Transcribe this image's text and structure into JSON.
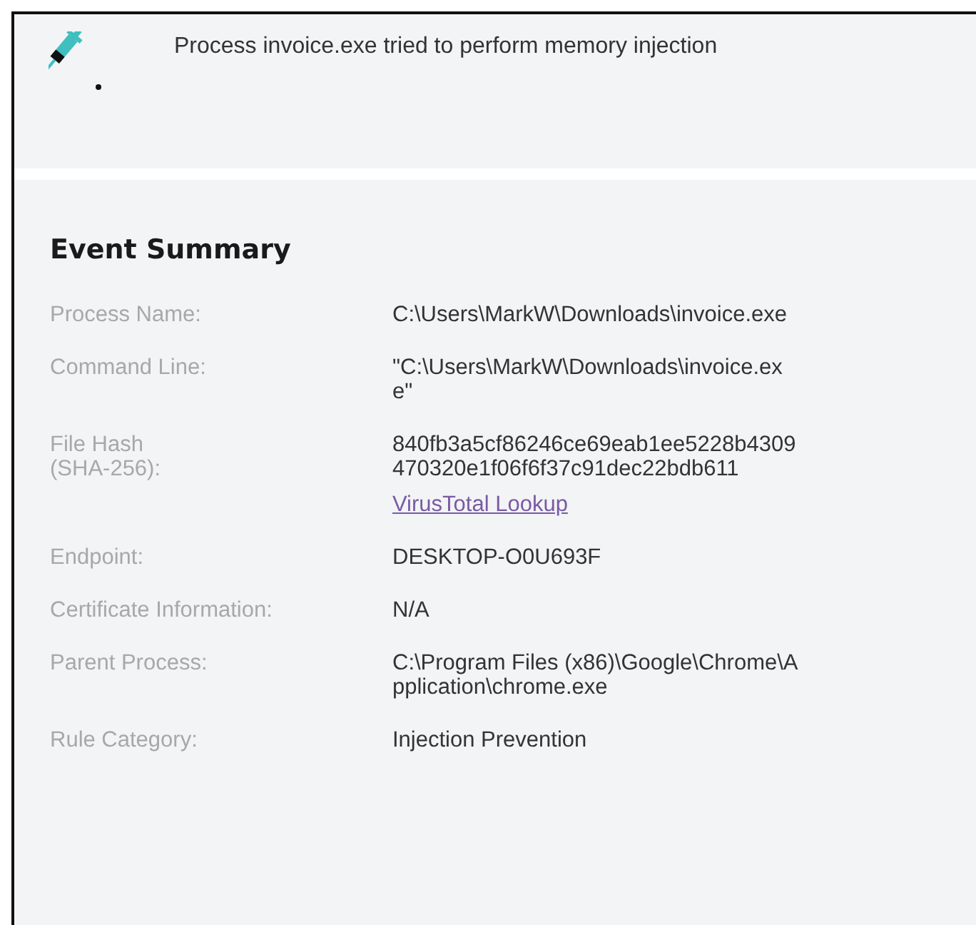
{
  "alert": {
    "message": "Process invoice.exe tried to perform memory injection"
  },
  "summary": {
    "title": "Event Summary",
    "rows": [
      {
        "label": [
          "Process Name:"
        ],
        "value": [
          "C:\\Users\\MarkW\\Downloads\\invoice.exe"
        ]
      },
      {
        "label": [
          "Command Line:"
        ],
        "value": [
          "\"C:\\Users\\MarkW\\Downloads\\invoice.ex",
          "e\""
        ]
      },
      {
        "label": [
          "File Hash",
          "(SHA-256):"
        ],
        "value": [
          "840fb3a5cf86246ce69eab1ee5228b4309",
          "470320e1f06f6f37c91dec22bdb611"
        ],
        "link": "VirusTotal Lookup"
      },
      {
        "label": [
          "Endpoint:"
        ],
        "value": [
          "DESKTOP-O0U693F"
        ]
      },
      {
        "label": [
          "Certificate Information:"
        ],
        "value": [
          "N/A"
        ]
      },
      {
        "label": [
          "Parent Process:"
        ],
        "value": [
          "C:\\Program Files (x86)\\Google\\Chrome\\A",
          "pplication\\chrome.exe"
        ]
      },
      {
        "label": [
          "Rule Category:"
        ],
        "value": [
          "Injection Prevention"
        ]
      }
    ]
  }
}
